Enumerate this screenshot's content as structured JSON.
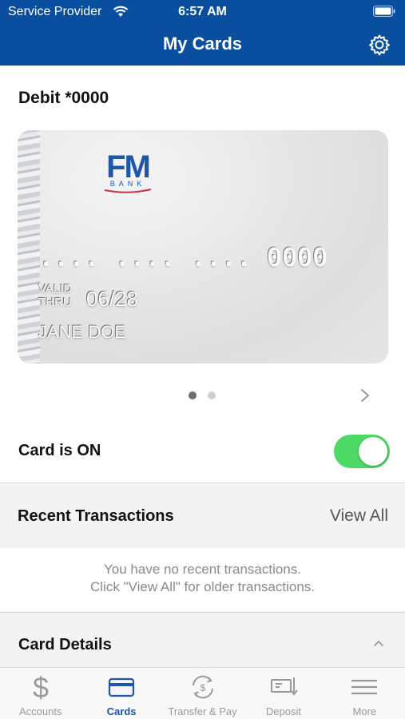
{
  "status_bar": {
    "carrier": "Service Provider",
    "time": "6:57 AM"
  },
  "nav": {
    "title": "My Cards"
  },
  "card": {
    "name": "Debit *0000",
    "brand_logo_text": "FM",
    "brand_sub_text": "BANK",
    "number_mask": ".... .... .... 0000",
    "valid_label": "VALID\nTHRU",
    "valid_thru": "06/28",
    "holder": "JANE DOE"
  },
  "pager": {
    "pages": 2,
    "current": 1
  },
  "card_toggle": {
    "label": "Card is ON",
    "on": true
  },
  "recent": {
    "title": "Recent Transactions",
    "view_all": "View All",
    "empty_line1": "You have no recent transactions.",
    "empty_line2": "Click \"View All\" for older transactions."
  },
  "details": {
    "title": "Card Details"
  },
  "tabs": [
    {
      "label": "Accounts",
      "icon": "dollar-icon"
    },
    {
      "label": "Cards",
      "icon": "card-icon"
    },
    {
      "label": "Transfer & Pay",
      "icon": "transfer-icon"
    },
    {
      "label": "Deposit",
      "icon": "deposit-icon"
    },
    {
      "label": "More",
      "icon": "menu-icon"
    }
  ],
  "colors": {
    "brand_blue": "#0a4f9f",
    "toggle_on": "#4cd964",
    "active_tab": "#1c57a8"
  }
}
